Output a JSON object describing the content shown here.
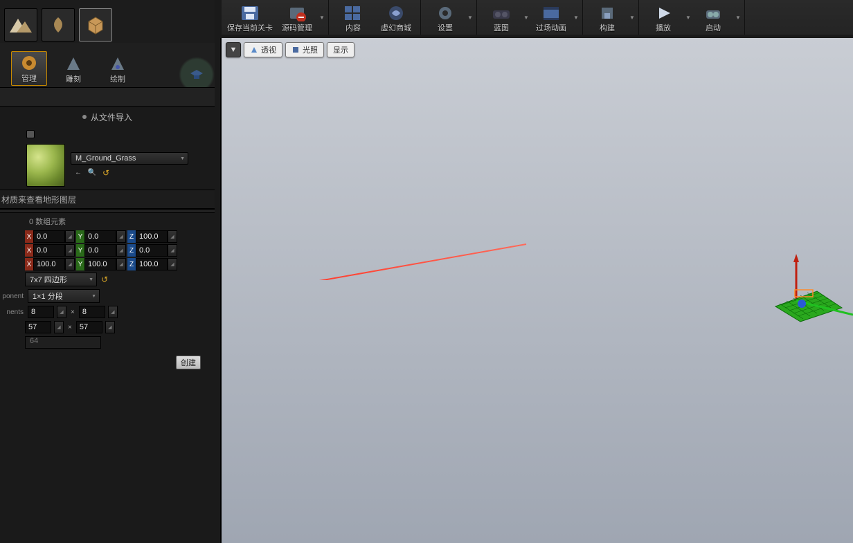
{
  "toolbar": {
    "save": "保存当前关卡",
    "source": "源码管理",
    "content": "内容",
    "marketplace": "虚幻商城",
    "settings": "设置",
    "blueprint": "蓝图",
    "cinematics": "过场动画",
    "build": "构建",
    "play": "播放",
    "launch": "启动"
  },
  "mode_tabs": {
    "manage": "管理",
    "sculpt": "雕刻",
    "paint": "绘制"
  },
  "import": {
    "label": "从文件导入"
  },
  "material": {
    "name": "M_Ground_Grass"
  },
  "layers_hint": "材质来查看地形图层",
  "array_count": "0 数组元素",
  "location": {
    "x": "0.0",
    "y": "0.0",
    "z": "100.0"
  },
  "rotation": {
    "x": "0.0",
    "y": "0.0",
    "z": "0.0"
  },
  "scale": {
    "x": "100.0",
    "y": "100.0",
    "z": "100.0"
  },
  "section_size": {
    "value": "7x7 四边形"
  },
  "sections_per": {
    "label_trunc": "ponent",
    "value": "1×1 分段"
  },
  "num_components": {
    "label_trunc": "nents",
    "a": "8",
    "b": "8"
  },
  "resolution": {
    "a": "57",
    "b": "57"
  },
  "total": "64",
  "create_label": "创建",
  "viewport": {
    "perspective": "透视",
    "lit": "光照",
    "show": "显示"
  }
}
